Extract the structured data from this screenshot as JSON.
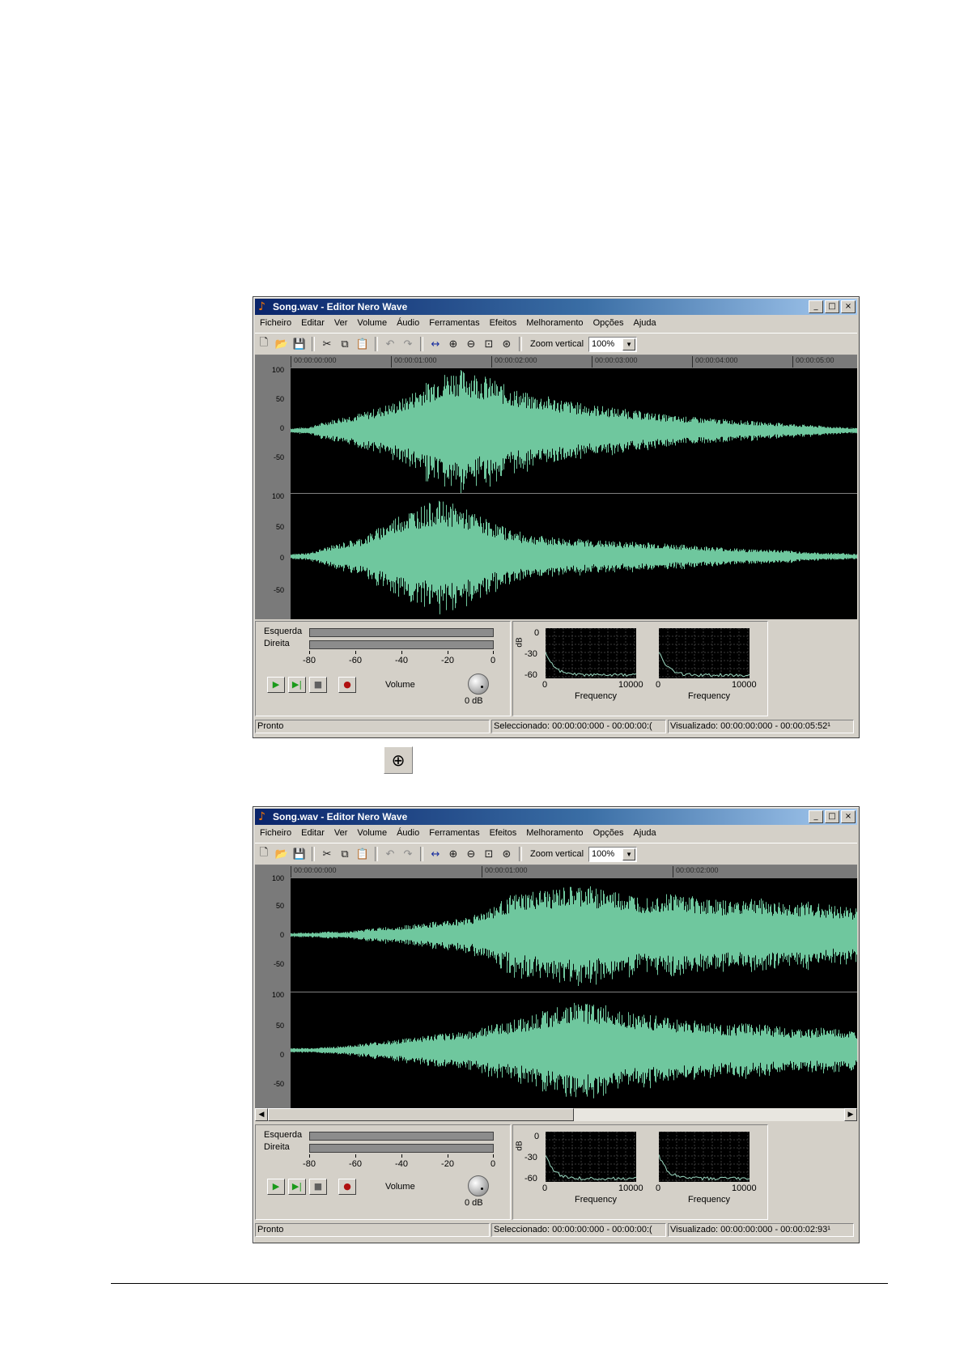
{
  "windows": [
    {
      "title": "Song.wav - Editor Nero Wave",
      "menu": [
        "Ficheiro",
        "Editar",
        "Ver",
        "Volume",
        "Áudio",
        "Ferramentas",
        "Efeitos",
        "Melhoramento",
        "Opções",
        "Ajuda"
      ],
      "toolbar": {
        "zoom_label": "Zoom vertical",
        "zoom_value": "100%"
      },
      "timeline": [
        "00:00:00:000",
        "00:00:01:000",
        "00:00:02:000",
        "00:00:03:000",
        "00:00:04:000",
        "00:00:05:00"
      ],
      "y_labels": [
        "100",
        "50",
        "0",
        "-50"
      ],
      "meter": {
        "left_label": "Esquerda",
        "right_label": "Direita",
        "scale": [
          "-80",
          "-60",
          "-40",
          "-20",
          "0"
        ],
        "volume_label": "Volume",
        "db_label": "0 dB"
      },
      "spectrum": {
        "db_axis": "dB",
        "y_ticks": [
          "0",
          "-30",
          "-60"
        ],
        "x_ticks": [
          "0",
          "10000"
        ],
        "xlabel": "Frequency"
      },
      "status": {
        "ready": "Pronto",
        "selected": "Seleccionado: 00:00:00:000 - 00:00:00:(",
        "visible": "Visualizado: 00:00:00:000 - 00:00:05:52¹"
      }
    },
    {
      "title": "Song.wav - Editor Nero Wave",
      "menu": [
        "Ficheiro",
        "Editar",
        "Ver",
        "Volume",
        "Áudio",
        "Ferramentas",
        "Efeitos",
        "Melhoramento",
        "Opções",
        "Ajuda"
      ],
      "toolbar": {
        "zoom_label": "Zoom vertical",
        "zoom_value": "100%"
      },
      "timeline": [
        "00:00:00:000",
        "00:00:01:000",
        "00:00:02:000"
      ],
      "y_labels": [
        "100",
        "50",
        "0",
        "-50"
      ],
      "meter": {
        "left_label": "Esquerda",
        "right_label": "Direita",
        "scale": [
          "-80",
          "-60",
          "-40",
          "-20",
          "0"
        ],
        "volume_label": "Volume",
        "db_label": "0 dB"
      },
      "spectrum": {
        "db_axis": "dB",
        "y_ticks": [
          "0",
          "-30",
          "-60"
        ],
        "x_ticks": [
          "0",
          "10000"
        ],
        "xlabel": "Frequency"
      },
      "status": {
        "ready": "Pronto",
        "selected": "Seleccionado: 00:00:00:000 - 00:00:00:(",
        "visible": "Visualizado: 00:00:00:000 - 00:00:02:93¹"
      }
    }
  ],
  "colors": {
    "waveform": "#6fc79e",
    "titlebar": "#0a246a",
    "window": "#d4d0c8"
  },
  "icons": [
    "app-icon",
    "new-icon",
    "open-icon",
    "save-icon",
    "cut-icon",
    "copy-icon",
    "paste-icon",
    "undo-icon",
    "redo-icon",
    "fit-icon",
    "zoom-in-icon",
    "zoom-out-icon",
    "zoom-selection-icon",
    "zoom-full-icon",
    "zoom-in-caption-icon"
  ]
}
